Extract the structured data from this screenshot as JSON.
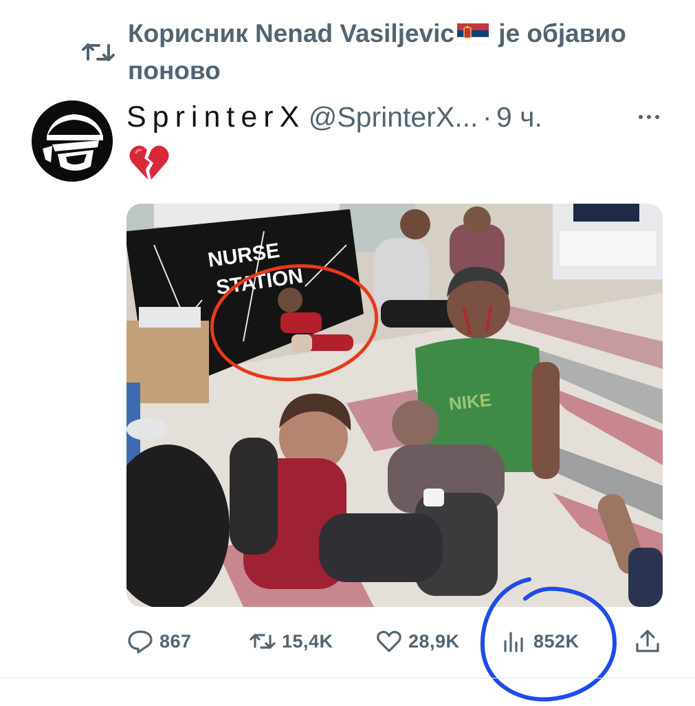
{
  "repost": {
    "text_before_flag": "Корисник Nenad Vasiljevic",
    "text_after_flag": " је објавио поново",
    "icon": "repost-icon",
    "flag": "serbia-flag"
  },
  "author": {
    "display_name": "SprinterX",
    "handle": "@SprinterX...",
    "separator": "·",
    "time": "9 ч.",
    "avatar": "avatar-mask-logo"
  },
  "tweet": {
    "emoji": "broken-heart-icon"
  },
  "media": {
    "caption_sign_line1": "NURSE",
    "caption_sign_line2": "STATION",
    "annotation_color": "#e8391c"
  },
  "actions": {
    "replies": "867",
    "reposts": "15,4K",
    "likes": "28,9K",
    "views": "852K"
  },
  "colors": {
    "secondary_text": "#536471",
    "views_highlight": "#1d4ce8"
  }
}
